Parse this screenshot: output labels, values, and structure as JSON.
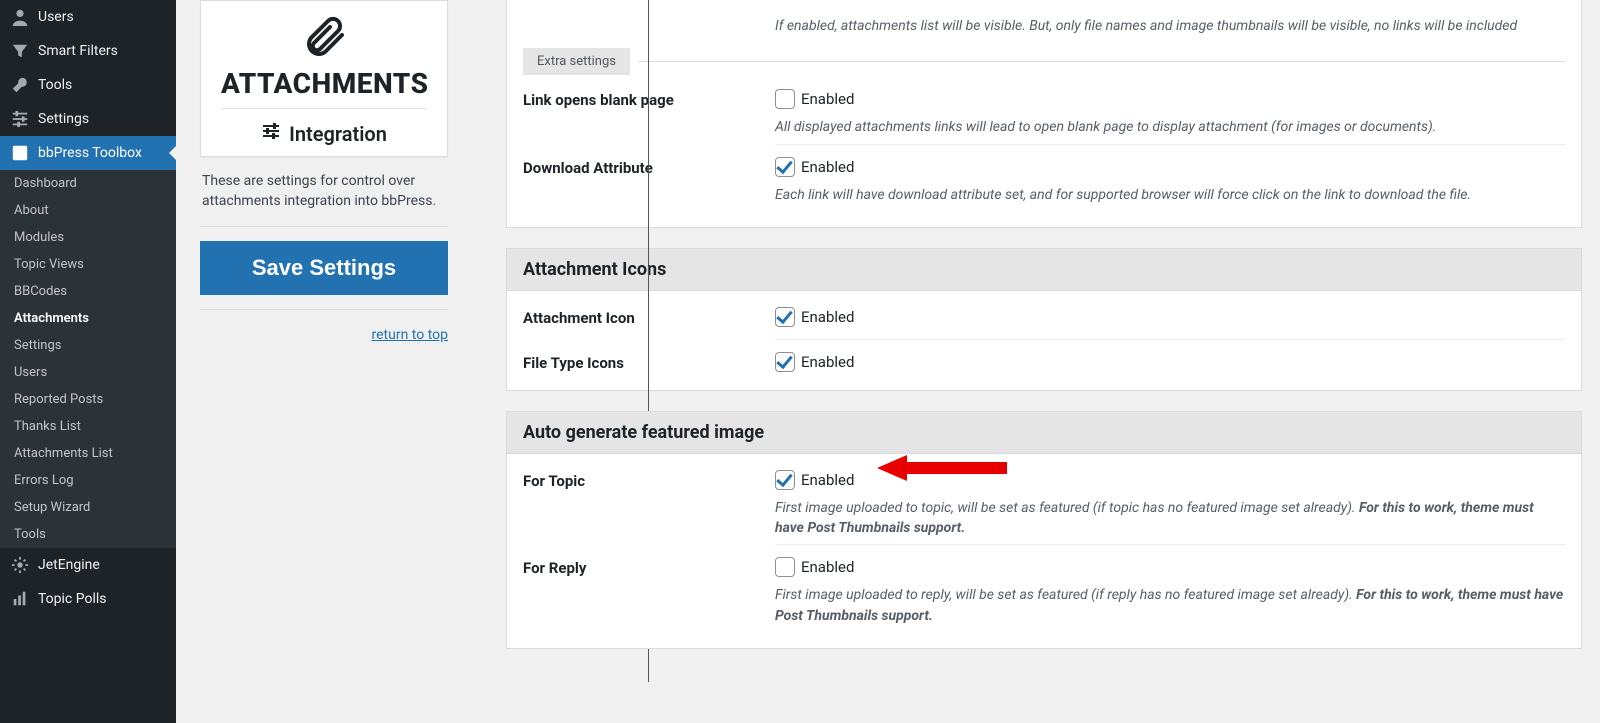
{
  "sidebar": {
    "main": [
      {
        "label": "Users",
        "icon": "user"
      },
      {
        "label": "Smart Filters",
        "icon": "filter"
      },
      {
        "label": "Tools",
        "icon": "wrench"
      },
      {
        "label": "Settings",
        "icon": "sliders"
      },
      {
        "label": "bbPress Toolbox",
        "icon": "box",
        "current": true
      }
    ],
    "sub": [
      {
        "label": "Dashboard"
      },
      {
        "label": "About"
      },
      {
        "label": "Modules"
      },
      {
        "label": "Topic Views"
      },
      {
        "label": "BBCodes"
      },
      {
        "label": "Attachments",
        "active": true
      },
      {
        "label": "Settings"
      },
      {
        "label": "Users"
      },
      {
        "label": "Reported Posts"
      },
      {
        "label": "Thanks List"
      },
      {
        "label": "Attachments List"
      },
      {
        "label": "Errors Log"
      },
      {
        "label": "Setup Wizard"
      },
      {
        "label": "Tools"
      }
    ],
    "tail": [
      {
        "label": "JetEngine",
        "icon": "gear"
      },
      {
        "label": "Topic Polls",
        "icon": "bars"
      }
    ]
  },
  "card": {
    "title": "ATTACHMENTS",
    "subtitle": "Integration",
    "desc": "These are settings for control over attachments integration into bbPress.",
    "save": "Save Settings",
    "return": "return to top"
  },
  "extra_fieldset": "Extra settings",
  "top": {
    "hide_help": "If enabled, attachments list will be visible. But, only file names and image thumbnails will be visible, no links will be included",
    "blank_label": "Link opens blank page",
    "blank_enabled": "Enabled",
    "blank_checked": false,
    "blank_help": "All displayed attachments links will lead to open blank page to display attachment (for images or documents).",
    "dl_label": "Download Attribute",
    "dl_enabled": "Enabled",
    "dl_checked": true,
    "dl_help": "Each link will have download attribute set, and for supported browser will force click on the link to download the file."
  },
  "icons": {
    "heading": "Attachment Icons",
    "a_label": "Attachment Icon",
    "a_enabled": "Enabled",
    "a_checked": true,
    "f_label": "File Type Icons",
    "f_enabled": "Enabled",
    "f_checked": true
  },
  "featured": {
    "heading": "Auto generate featured image",
    "t_label": "For Topic",
    "t_enabled": "Enabled",
    "t_checked": true,
    "t_help_a": "First image uploaded to topic, will be set as featured (if topic has no featured image set already). ",
    "t_help_b": "For this to work, theme must have Post Thumbnails support.",
    "r_label": "For Reply",
    "r_enabled": "Enabled",
    "r_checked": false,
    "r_help_a": "First image uploaded to reply, will be set as featured (if reply has no featured image set already). ",
    "r_help_b": "For this to work, theme must have Post Thumbnails support."
  }
}
